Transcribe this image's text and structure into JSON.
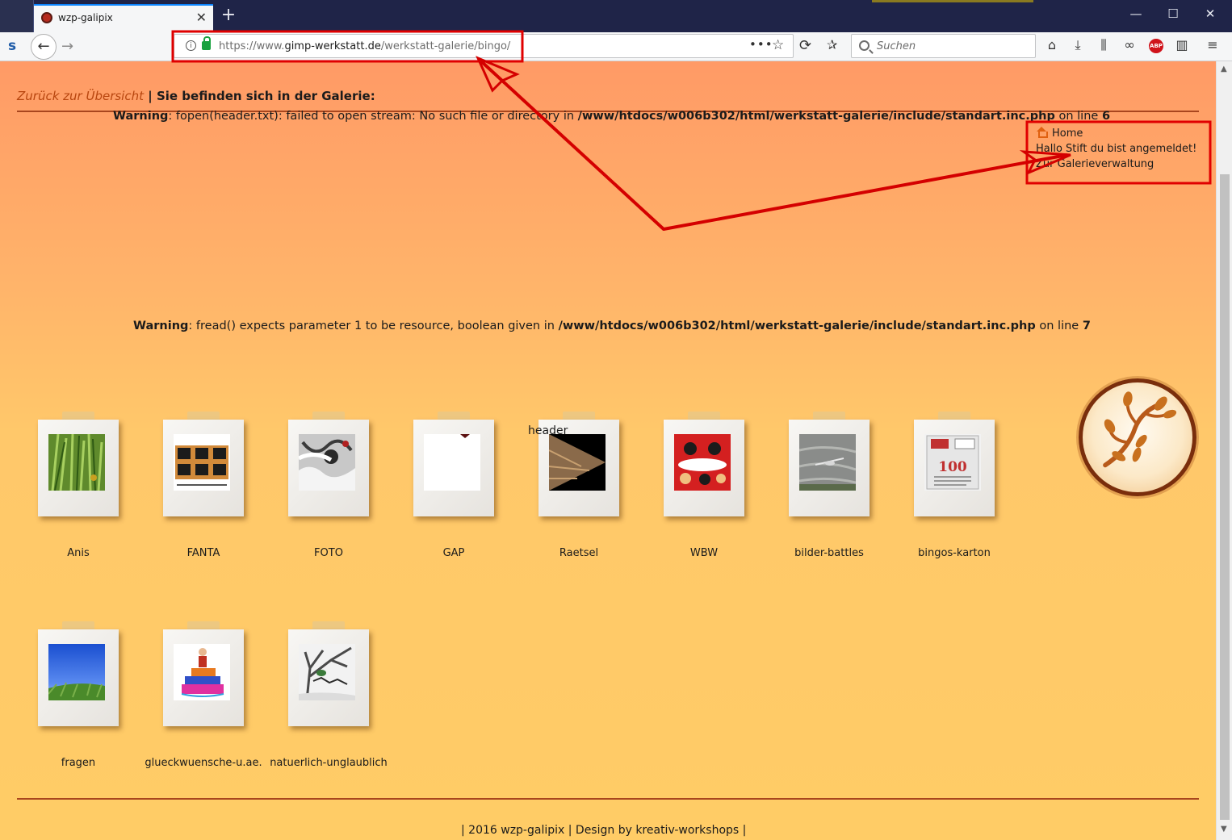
{
  "browser": {
    "tab_title": "wzp-galipix",
    "new_tab": "+",
    "sidebar_letter": "s",
    "url_scheme_host": "https://www.",
    "url_host": "gimp-werkstatt.de",
    "url_path": "/werkstatt-galerie/bingo/",
    "url_more": "•••",
    "search_placeholder": "Suchen",
    "abp_label": "ABP"
  },
  "page": {
    "back_link": "Zurück zur Übersicht",
    "separator": " | ",
    "gallery_location": "Sie befinden sich in der Galerie:",
    "warning1": {
      "label": "Warning",
      "message": ": fopen(header.txt): failed to open stream: No such file or directory in ",
      "path": "/www/htdocs/w006b302/html/werkstatt-galerie/include/standart.inc.php",
      "online": " on line ",
      "line": "6"
    },
    "warning2": {
      "label": "Warning",
      "message": ": fread() expects parameter 1 to be resource, boolean given in ",
      "path": "/www/htdocs/w006b302/html/werkstatt-galerie/include/standart.inc.php",
      "online": " on line ",
      "line": "7"
    },
    "user_menu": {
      "home": "Home",
      "greeting": "Hallo Stift du bist angemeldet!",
      "admin_link": "Zur Galerieverwaltung"
    },
    "header_text": "header",
    "galleries": [
      {
        "label": "Anis"
      },
      {
        "label": "FANTA"
      },
      {
        "label": "FOTO"
      },
      {
        "label": "GAP"
      },
      {
        "label": "Raetsel"
      },
      {
        "label": "WBW"
      },
      {
        "label": "bilder-battles"
      },
      {
        "label": "bingos-karton"
      },
      {
        "label": "fragen"
      },
      {
        "label": "glueckwuensche-u.ae."
      },
      {
        "label": "natuerlich-unglaublich"
      }
    ],
    "bingo_card_number": "100",
    "footer": "| 2016 wzp-galipix | Design by kreativ-workshops |"
  },
  "colors": {
    "link": "#b8460f",
    "annotation": "#e00000",
    "rule": "#a8461e"
  }
}
